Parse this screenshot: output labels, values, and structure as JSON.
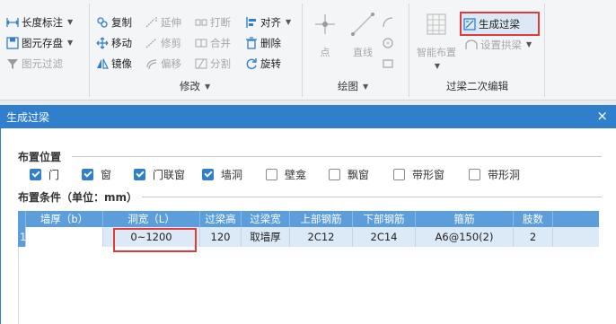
{
  "ribbon": {
    "left_group": {
      "dimension_label": "长度标注",
      "save_label": "图元存盘",
      "filter_label": "图元过滤"
    },
    "modify_group": {
      "label": "修改",
      "copy": "复制",
      "extend": "延伸",
      "break": "打断",
      "align": "对齐",
      "move": "移动",
      "trim": "修剪",
      "merge": "合并",
      "delete": "删除",
      "mirror": "镜像",
      "offset": "偏移",
      "split": "分割",
      "rotate": "旋转"
    },
    "draw_group": {
      "label": "绘图",
      "point": "点",
      "line": "直线"
    },
    "lintel_group": {
      "label": "过梁二次编辑",
      "smart_layout": "智能布置",
      "generate_lintel": "生成过梁",
      "set_arch": "设置拱梁"
    }
  },
  "dialog": {
    "title": "生成过梁",
    "close": "×",
    "position_section": "布置位置",
    "condition_section": "布置条件（单位：mm）",
    "options": [
      {
        "label": "门",
        "checked": true
      },
      {
        "label": "窗",
        "checked": true
      },
      {
        "label": "门联窗",
        "checked": true
      },
      {
        "label": "墙洞",
        "checked": true
      },
      {
        "label": "壁龛",
        "checked": false
      },
      {
        "label": "飘窗",
        "checked": false
      },
      {
        "label": "带形窗",
        "checked": false
      },
      {
        "label": "带形洞",
        "checked": false
      }
    ],
    "table": {
      "headers": [
        "",
        "墙厚（b）",
        "洞宽（L）",
        "过梁高",
        "过梁宽",
        "上部钢筋",
        "下部钢筋",
        "箍筋",
        "肢数"
      ],
      "rows": [
        [
          "1",
          "",
          "0~1200",
          "120",
          "取墙厚",
          "2C12",
          "2C14",
          "A6@150(2)",
          "2"
        ]
      ]
    }
  },
  "colors": {
    "title_bar": "#2f7fcd",
    "header": "#5c9ddc",
    "selected_row": "#dce9f7",
    "highlight_border": "#e23a3a"
  }
}
